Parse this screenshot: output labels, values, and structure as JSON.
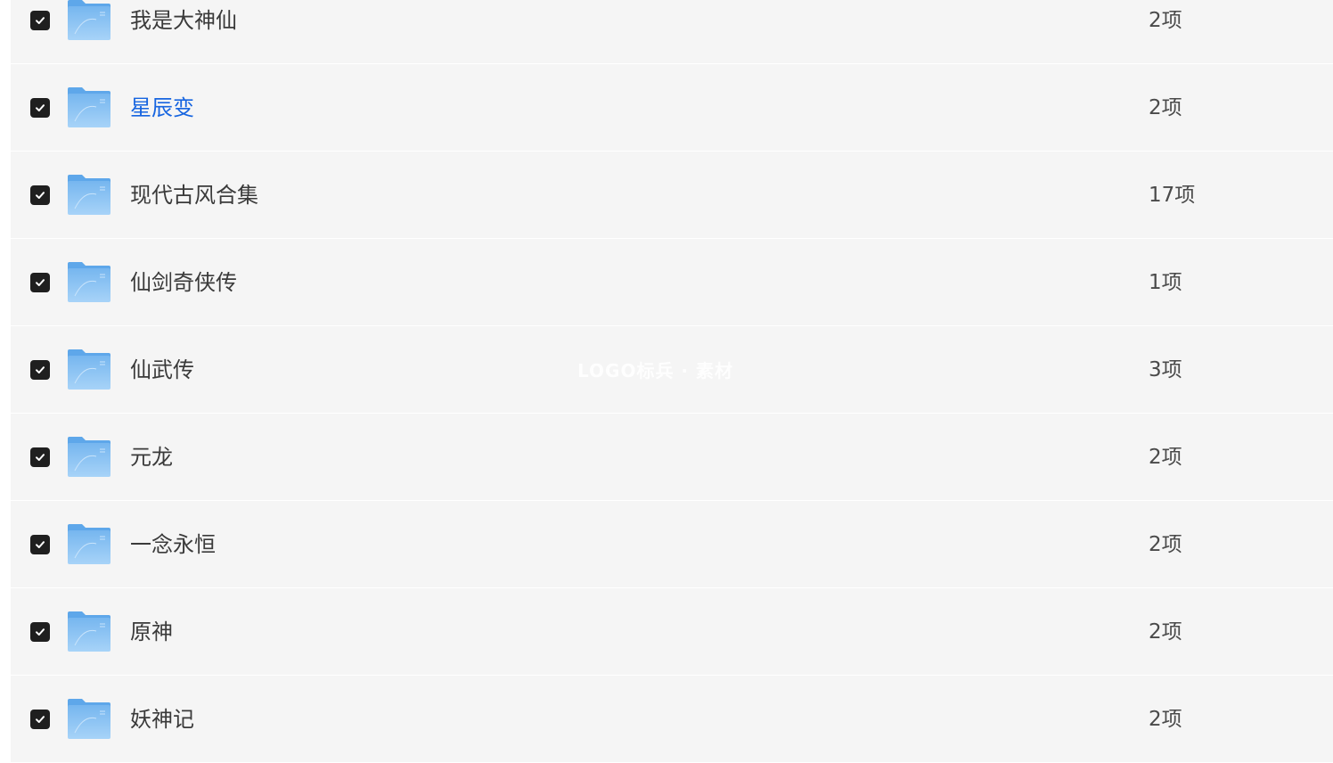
{
  "folders": [
    {
      "name": "我是大神仙",
      "count": "2项",
      "checked": true
    },
    {
      "name": "星辰变",
      "count": "2项",
      "checked": true,
      "active": true
    },
    {
      "name": "现代古风合集",
      "count": "17项",
      "checked": true
    },
    {
      "name": "仙剑奇侠传",
      "count": "1项",
      "checked": true
    },
    {
      "name": "仙武传",
      "count": "3项",
      "checked": true
    },
    {
      "name": "元龙",
      "count": "2项",
      "checked": true
    },
    {
      "name": "一念永恒",
      "count": "2项",
      "checked": true
    },
    {
      "name": "原神",
      "count": "2项",
      "checked": true
    },
    {
      "name": "妖神记",
      "count": "2项",
      "checked": true
    }
  ],
  "watermark": "LOGO标兵 · 素材",
  "colors": {
    "row_bg": "#f5f5f5",
    "checkbox": "#1f1f1f",
    "active_link": "#1765e0",
    "folder": "#8cc4f4"
  },
  "icons": {
    "checkbox": "checkbox-checked-icon",
    "folder": "folder-icon"
  }
}
